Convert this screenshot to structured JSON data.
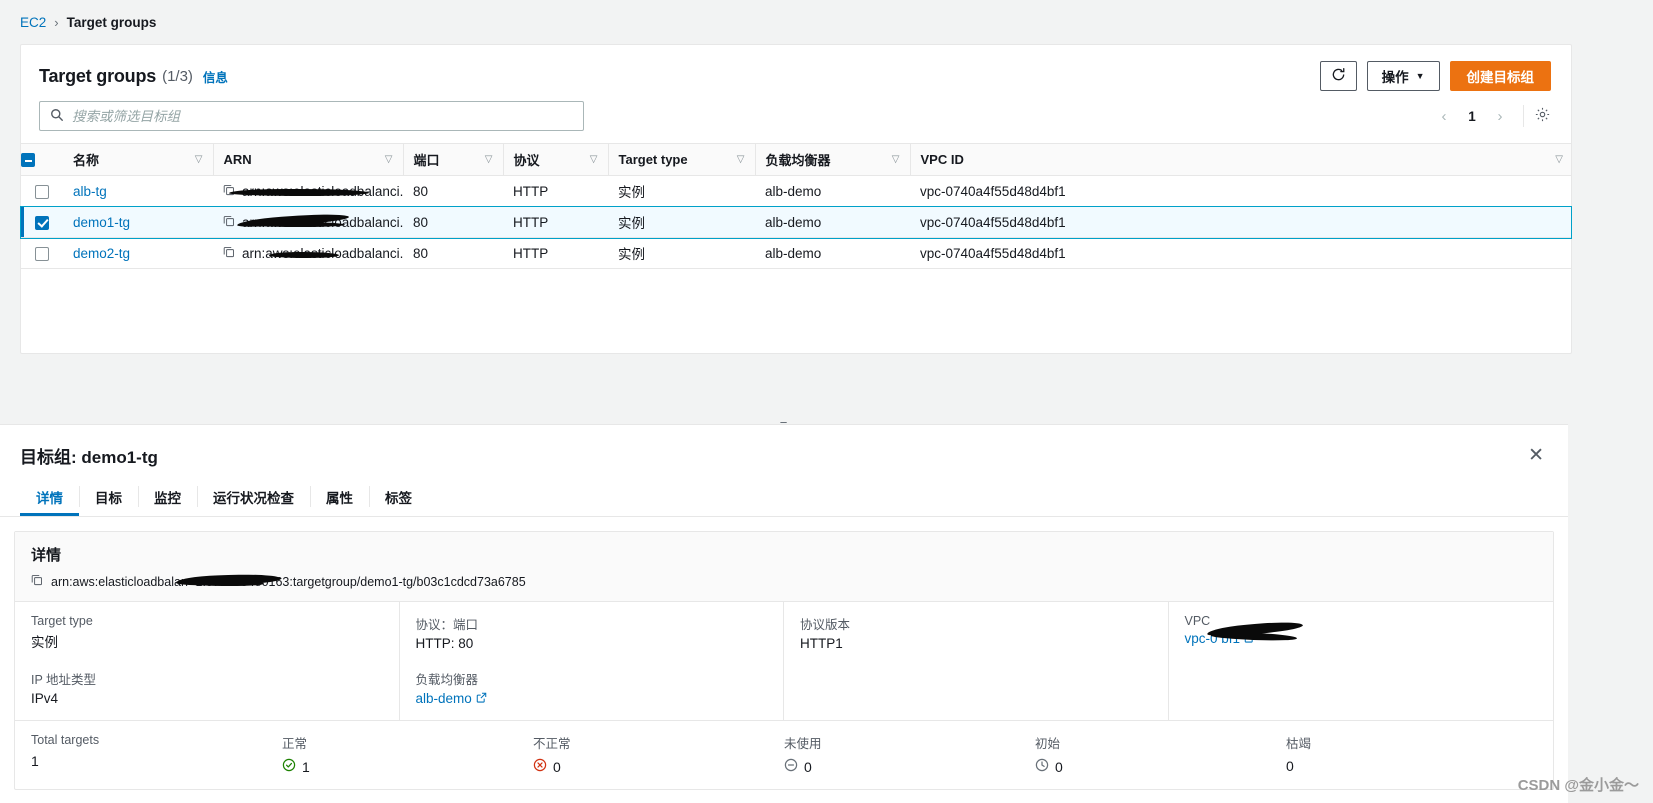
{
  "breadcrumb": {
    "root": "EC2",
    "separator": "›",
    "current": "Target groups"
  },
  "panel": {
    "title": "Target groups",
    "count": "(1/3)",
    "info_link": "信息",
    "refresh_icon": "refresh-icon",
    "actions_button": "操作",
    "actions_caret": "▼",
    "create_button": "创建目标组"
  },
  "search": {
    "placeholder": "搜索或筛选目标组",
    "value": ""
  },
  "pagination": {
    "prev": "‹",
    "page": "1",
    "next": "›",
    "settings_icon": "gear-icon"
  },
  "table": {
    "columns": [
      {
        "label": "名称",
        "sortable": true
      },
      {
        "label": "ARN",
        "sortable": true
      },
      {
        "label": "端口",
        "sortable": true
      },
      {
        "label": "协议",
        "sortable": true
      },
      {
        "label": "Target type",
        "sortable": true
      },
      {
        "label": "负载均衡器",
        "sortable": true
      },
      {
        "label": "VPC ID",
        "sortable": true
      }
    ],
    "rows": [
      {
        "selected": false,
        "name": "alb-tg",
        "arn": "arn:aws:elasticloadbalanci...",
        "port": "80",
        "protocol": "HTTP",
        "target_type": "实例",
        "load_balancer": "alb-demo",
        "vpc_id": "vpc-0740a4f55d48d4bf1"
      },
      {
        "selected": true,
        "name": "demo1-tg",
        "arn": "arn:aws:elasticloadbalanci...",
        "port": "80",
        "protocol": "HTTP",
        "target_type": "实例",
        "load_balancer": "alb-demo",
        "vpc_id": "vpc-0740a4f55d48d4bf1"
      },
      {
        "selected": false,
        "name": "demo2-tg",
        "arn": "arn:aws:elasticloadbalanci...",
        "port": "80",
        "protocol": "HTTP",
        "target_type": "实例",
        "load_balancer": "alb-demo",
        "vpc_id": "vpc-0740a4f55d48d4bf1"
      }
    ]
  },
  "splitter": {
    "handle": "="
  },
  "detail": {
    "title": "目标组: demo1-tg",
    "close_icon": "close-icon",
    "tabs": [
      {
        "label": "详情",
        "active": true
      },
      {
        "label": "目标",
        "active": false
      },
      {
        "label": "监控",
        "active": false
      },
      {
        "label": "运行状况检查",
        "active": false
      },
      {
        "label": "属性",
        "active": false
      },
      {
        "label": "标签",
        "active": false
      }
    ],
    "section_title": "详情",
    "arn": "arn:aws:elasticloadbalan              -1:578298480163:targetgroup/demo1-tg/b03c1cdcd73a6785",
    "fields": {
      "target_type_label": "Target type",
      "target_type_value": "实例",
      "ip_type_label": "IP 地址类型",
      "ip_type_value": "IPv4",
      "protocol_port_label": "协议：端口",
      "protocol_port_value": "HTTP: 80",
      "load_balancer_label": "负载均衡器",
      "load_balancer_value": "alb-demo",
      "protocol_version_label": "协议版本",
      "protocol_version_value": "HTTP1",
      "vpc_label": "VPC",
      "vpc_value": "vpc-0                      bf1"
    },
    "stats": [
      {
        "label": "Total targets",
        "value": "1",
        "icon": ""
      },
      {
        "label": "正常",
        "value": "1",
        "icon": "check-circle-icon",
        "color": "#1d8102"
      },
      {
        "label": "不正常",
        "value": "0",
        "icon": "error-circle-icon",
        "color": "#d13212"
      },
      {
        "label": "未使用",
        "value": "0",
        "icon": "minus-circle-icon",
        "color": "#687078"
      },
      {
        "label": "初始",
        "value": "0",
        "icon": "clock-circle-icon",
        "color": "#687078"
      },
      {
        "label": "枯竭",
        "value": "0",
        "icon": "",
        "color": "#687078"
      }
    ]
  },
  "watermark": "CSDN @金小金～"
}
